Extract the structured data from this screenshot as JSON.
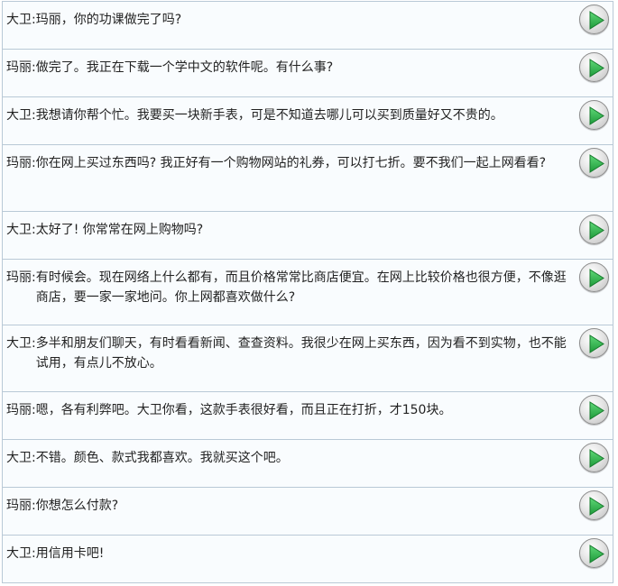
{
  "dialogue": [
    {
      "speaker": "大卫:",
      "text": "玛丽，你的功课做完了吗?"
    },
    {
      "speaker": "玛丽:",
      "text": "做完了。我正在下载一个学中文的软件呢。有什么事?"
    },
    {
      "speaker": "大卫:",
      "text": "我想请你帮个忙。我要买一块新手表，可是不知道去哪儿可以买到质量好又不贵的。"
    },
    {
      "speaker": "玛丽:",
      "text": "你在网上买过东西吗? 我正好有一个购物网站的礼券，可以打七折。要不我们一起上网看看?"
    },
    {
      "speaker": "大卫:",
      "text": "太好了! 你常常在网上购物吗?"
    },
    {
      "speaker": "玛丽:",
      "text": "有时候会。现在网络上什么都有，而且价格常常比商店便宜。在网上比较价格也很方便，不像逛商店，要一家一家地问。你上网都喜欢做什么?"
    },
    {
      "speaker": "大卫:",
      "text": "多半和朋友们聊天，有时看看新闻、查查资料。我很少在网上买东西，因为看不到实物，也不能试用，有点儿不放心。"
    },
    {
      "speaker": "玛丽:",
      "text": "嗯，各有利弊吧。大卫你看，这款手表很好看，而且正在打折，才150块。"
    },
    {
      "speaker": "大卫:",
      "text": "不错。颜色、款式我都喜欢。我就买这个吧。"
    },
    {
      "speaker": "玛丽:",
      "text": "你想怎么付款?"
    },
    {
      "speaker": "大卫:",
      "text": "用信用卡吧!"
    }
  ],
  "icons": {
    "play": "play-icon"
  },
  "colors": {
    "play_green": "#2bb34a",
    "row_border": "#b9c9d6",
    "row_background": "#f9fcfe"
  }
}
